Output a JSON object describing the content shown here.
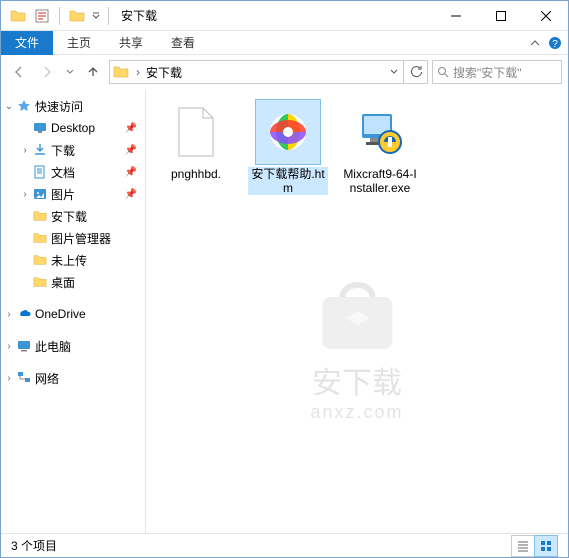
{
  "window": {
    "title": "安下载"
  },
  "ribbon": {
    "file": "文件",
    "tabs": [
      "主页",
      "共享",
      "查看"
    ]
  },
  "address": {
    "folder": "安下载",
    "search_placeholder": "搜索\"安下载\""
  },
  "nav": {
    "quick_access": "快速访问",
    "items": [
      {
        "label": "Desktop",
        "pinned": true,
        "icon": "desktop"
      },
      {
        "label": "下载",
        "pinned": true,
        "icon": "downloads",
        "expandable": true
      },
      {
        "label": "文档",
        "pinned": true,
        "icon": "documents"
      },
      {
        "label": "图片",
        "pinned": true,
        "icon": "pictures",
        "expandable": true
      },
      {
        "label": "安下载",
        "pinned": false,
        "icon": "folder"
      },
      {
        "label": "图片管理器",
        "pinned": false,
        "icon": "folder"
      },
      {
        "label": "未上传",
        "pinned": false,
        "icon": "folder"
      },
      {
        "label": "桌面",
        "pinned": false,
        "icon": "folder"
      }
    ],
    "onedrive": "OneDrive",
    "thispc": "此电脑",
    "network": "网络"
  },
  "files": [
    {
      "name": "pnghhbd.",
      "type": "blank",
      "selected": false
    },
    {
      "name": "安下载帮助.htm",
      "type": "htm",
      "selected": true
    },
    {
      "name": "Mixcraft9-64-Installer.exe",
      "type": "exe",
      "selected": false
    }
  ],
  "status": {
    "count": "3 个项目"
  },
  "watermark": {
    "line1": "安下载",
    "line2": "anxz.com"
  }
}
